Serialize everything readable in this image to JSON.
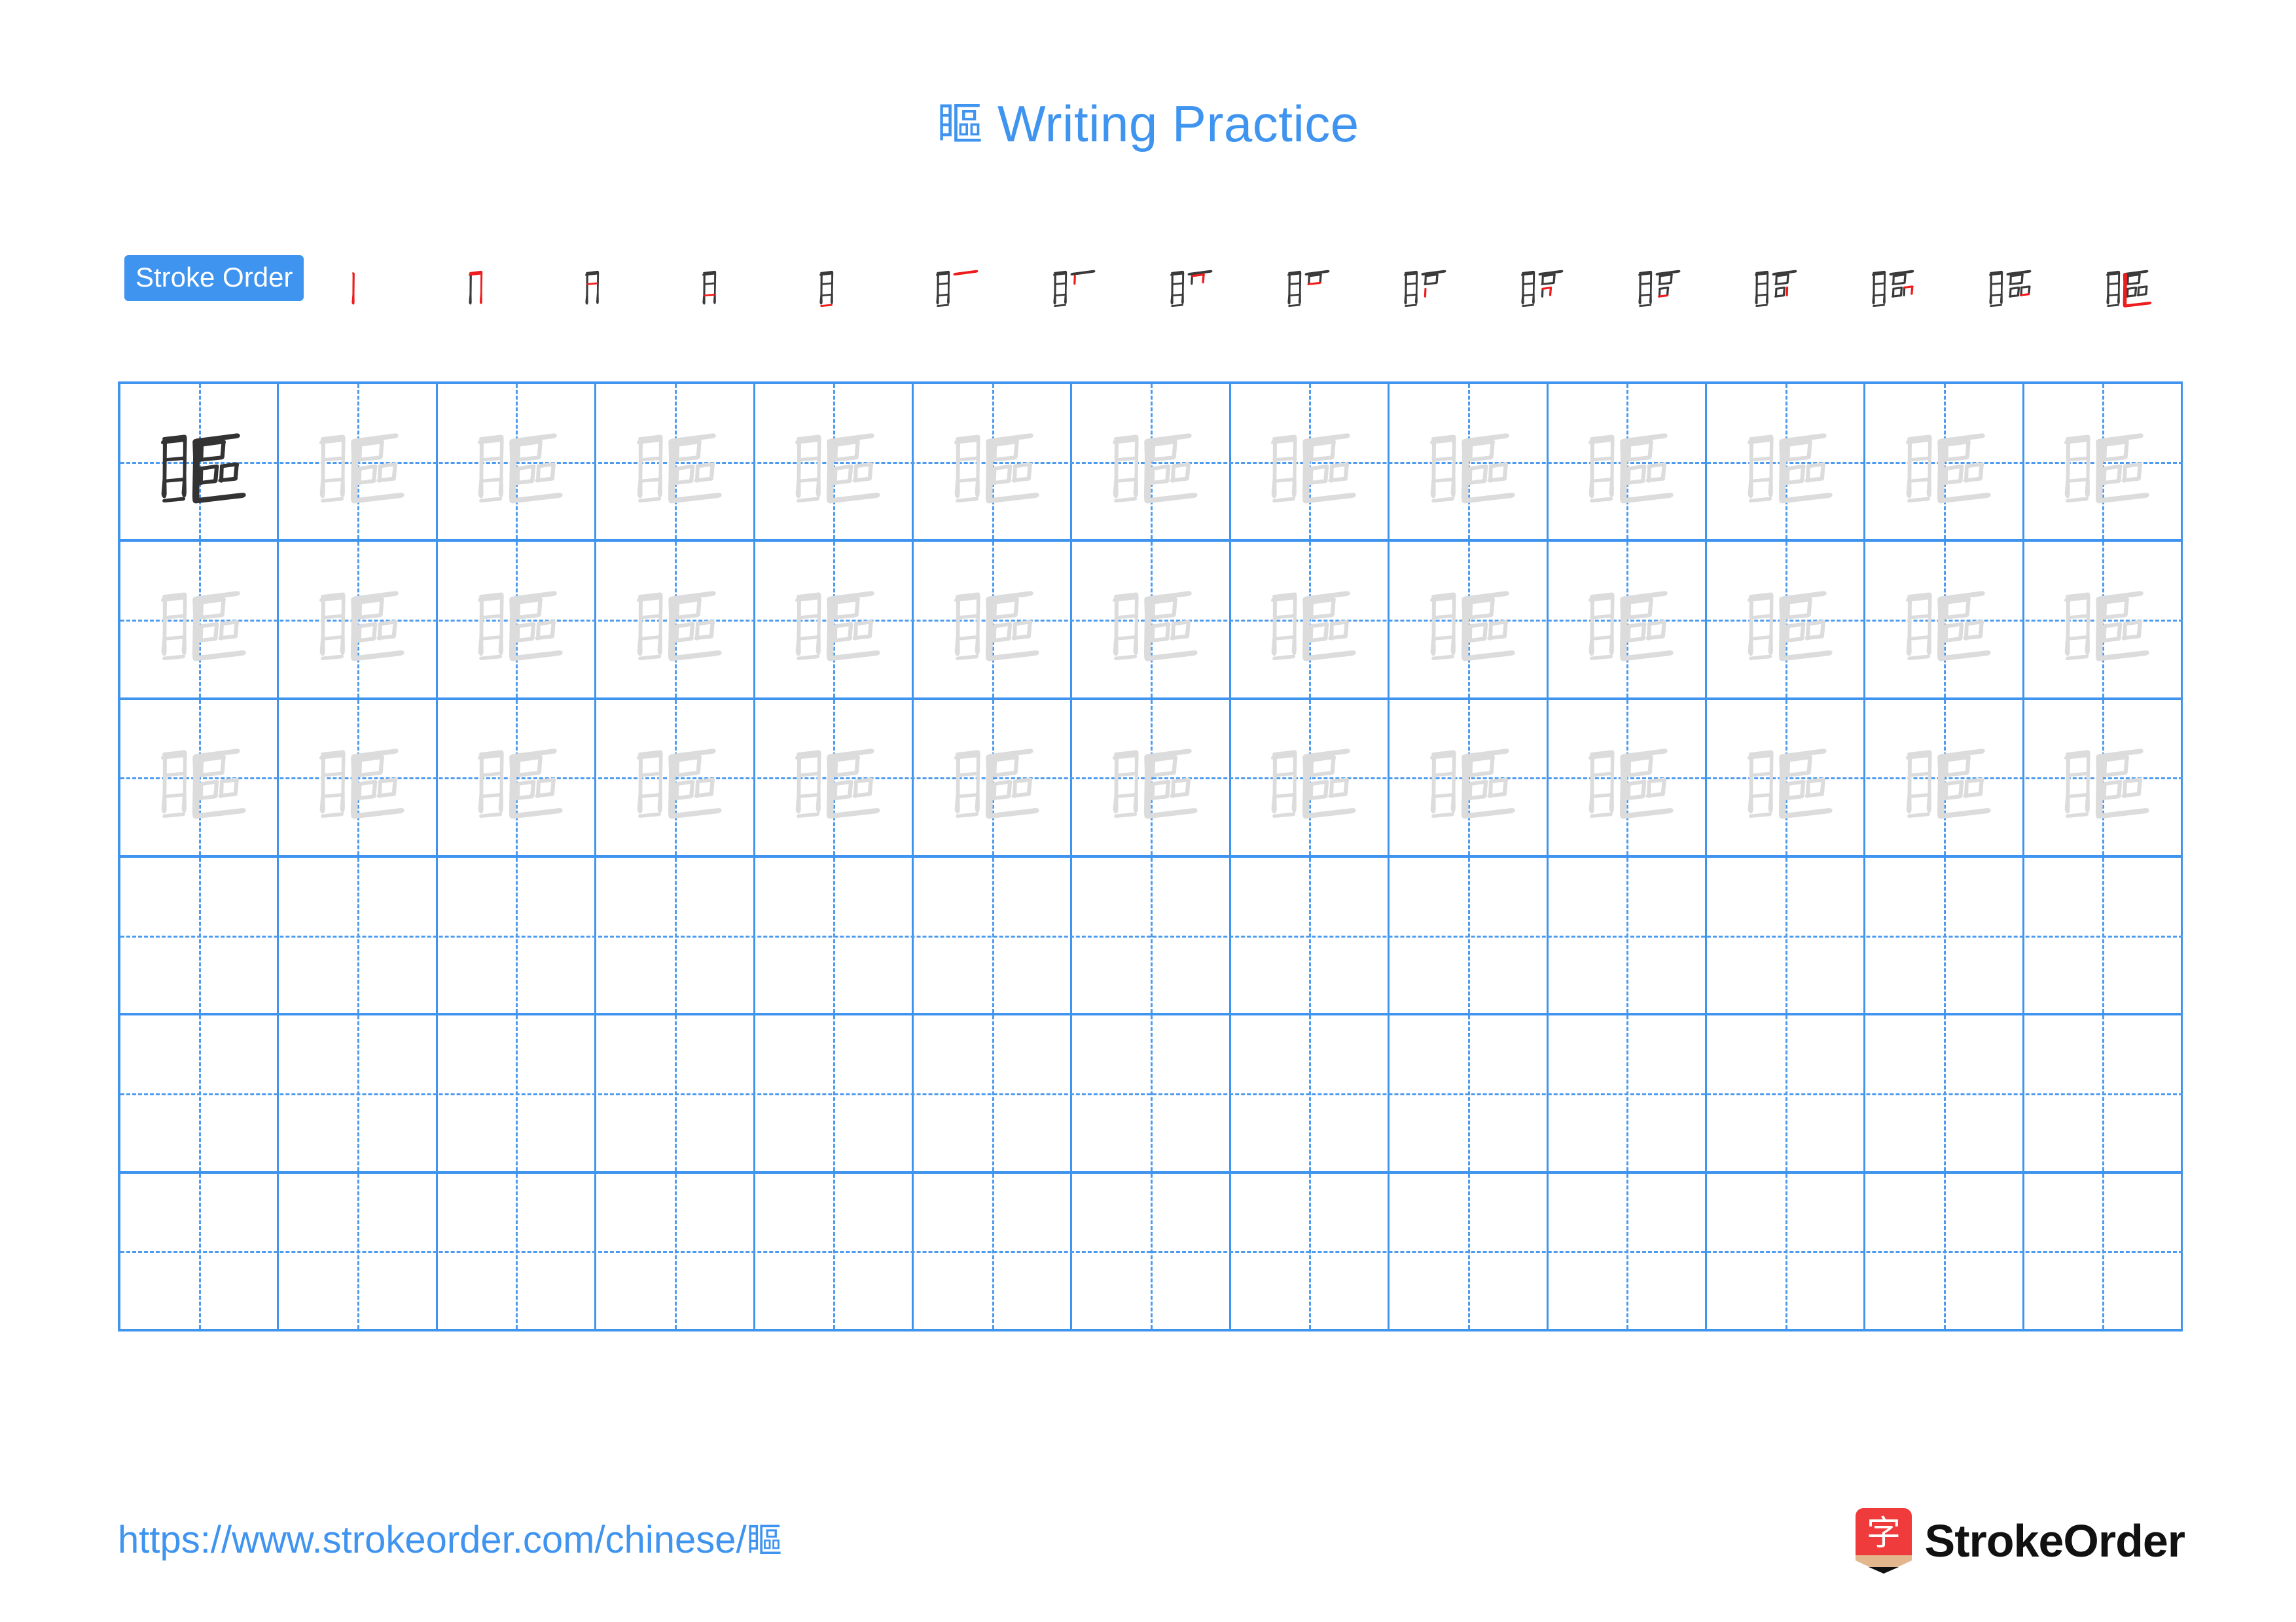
{
  "page": {
    "character": "瞘",
    "title_suffix": " Writing Practice",
    "background": "#ffffff"
  },
  "colors": {
    "accent_blue": "#3f94ef",
    "grid_line": "#3f94ef",
    "grid_dash": "#4d9bf0",
    "stroke_done": "#3a3a3a",
    "stroke_new": "#ee1c1c",
    "char_dark": "#333333",
    "char_faded": "#dcdcdc",
    "logo_red": "#ef3b3b",
    "logo_wood": "#e3b68d"
  },
  "stroke_order": {
    "badge_label": "Stroke Order",
    "total_strokes": 16,
    "steps": [
      {
        "index": 1,
        "strokes_drawn": 1
      },
      {
        "index": 2,
        "strokes_drawn": 2
      },
      {
        "index": 3,
        "strokes_drawn": 3
      },
      {
        "index": 4,
        "strokes_drawn": 4
      },
      {
        "index": 5,
        "strokes_drawn": 5
      },
      {
        "index": 6,
        "strokes_drawn": 6
      },
      {
        "index": 7,
        "strokes_drawn": 7
      },
      {
        "index": 8,
        "strokes_drawn": 8
      },
      {
        "index": 9,
        "strokes_drawn": 9
      },
      {
        "index": 10,
        "strokes_drawn": 10
      },
      {
        "index": 11,
        "strokes_drawn": 11
      },
      {
        "index": 12,
        "strokes_drawn": 12
      },
      {
        "index": 13,
        "strokes_drawn": 13
      },
      {
        "index": 14,
        "strokes_drawn": 14
      },
      {
        "index": 15,
        "strokes_drawn": 15
      },
      {
        "index": 16,
        "strokes_drawn": 16
      }
    ]
  },
  "practice_grid": {
    "columns": 13,
    "rows": 6,
    "row_contents": [
      {
        "row": 1,
        "cells": [
          "dark",
          "faded",
          "faded",
          "faded",
          "faded",
          "faded",
          "faded",
          "faded",
          "faded",
          "faded",
          "faded",
          "faded",
          "faded"
        ]
      },
      {
        "row": 2,
        "cells": [
          "faded",
          "faded",
          "faded",
          "faded",
          "faded",
          "faded",
          "faded",
          "faded",
          "faded",
          "faded",
          "faded",
          "faded",
          "faded"
        ]
      },
      {
        "row": 3,
        "cells": [
          "faded",
          "faded",
          "faded",
          "faded",
          "faded",
          "faded",
          "faded",
          "faded",
          "faded",
          "faded",
          "faded",
          "faded",
          "faded"
        ]
      },
      {
        "row": 4,
        "cells": [
          "blank",
          "blank",
          "blank",
          "blank",
          "blank",
          "blank",
          "blank",
          "blank",
          "blank",
          "blank",
          "blank",
          "blank",
          "blank"
        ]
      },
      {
        "row": 5,
        "cells": [
          "blank",
          "blank",
          "blank",
          "blank",
          "blank",
          "blank",
          "blank",
          "blank",
          "blank",
          "blank",
          "blank",
          "blank",
          "blank"
        ]
      },
      {
        "row": 6,
        "cells": [
          "blank",
          "blank",
          "blank",
          "blank",
          "blank",
          "blank",
          "blank",
          "blank",
          "blank",
          "blank",
          "blank",
          "blank",
          "blank"
        ]
      }
    ]
  },
  "footer": {
    "url_prefix": "https://www.strokeorder.com/chinese/",
    "url_char": "瞘",
    "brand_name": "StrokeOrder",
    "logo_glyph": "字"
  }
}
